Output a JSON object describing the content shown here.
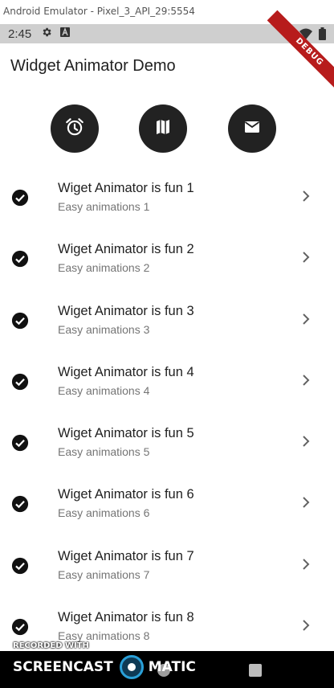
{
  "window": {
    "title": "Android Emulator - Pixel_3_API_29:5554"
  },
  "status_bar": {
    "time": "2:45",
    "icons": [
      "gear-icon",
      "a-icon",
      "wifi-icon",
      "battery-icon"
    ]
  },
  "debug_banner": "DEBUG",
  "app": {
    "title": "Widget Animator Demo",
    "actions": [
      {
        "icon": "alarm-icon"
      },
      {
        "icon": "map-icon"
      },
      {
        "icon": "email-icon"
      }
    ]
  },
  "list": [
    {
      "title": "Wiget Animator is fun 1",
      "subtitle": "Easy animations 1"
    },
    {
      "title": "Wiget Animator is fun 2",
      "subtitle": "Easy animations 2"
    },
    {
      "title": "Wiget Animator is fun 3",
      "subtitle": "Easy animations 3"
    },
    {
      "title": "Wiget Animator is fun 4",
      "subtitle": "Easy animations 4"
    },
    {
      "title": "Wiget Animator is fun 5",
      "subtitle": "Easy animations 5"
    },
    {
      "title": "Wiget Animator is fun 6",
      "subtitle": "Easy animations 6"
    },
    {
      "title": "Wiget Animator is fun 7",
      "subtitle": "Easy animations 7"
    },
    {
      "title": "Wiget Animator is fun 8",
      "subtitle": "Easy animations 8"
    }
  ],
  "watermark": {
    "recorded_with": "RECORDED WITH",
    "brand_left": "SCREENCAST",
    "brand_right": "MATIC"
  },
  "colors": {
    "action_button_bg": "#222222",
    "status_bar_bg": "#cfcfcf",
    "debug_banner_bg": "#b71c1c",
    "subtitle_text": "#757575"
  }
}
